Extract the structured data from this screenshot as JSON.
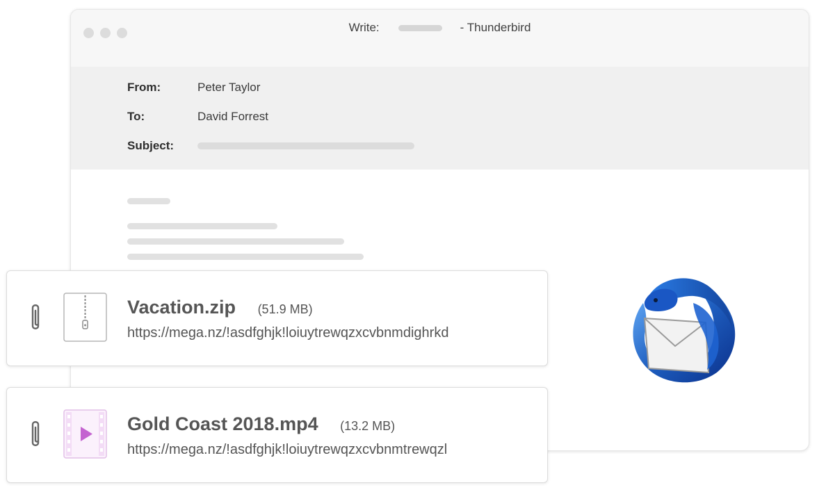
{
  "window": {
    "title_prefix": "Write:",
    "title_suffix": "- Thunderbird"
  },
  "compose": {
    "from_label": "From:",
    "from_value": "Peter Taylor",
    "to_label": "To:",
    "to_value": "David Forrest",
    "subject_label": "Subject:"
  },
  "attachments": [
    {
      "name": "Vacation.zip",
      "size": "(51.9 MB)",
      "link": "https://mega.nz/!asdfghjk!loiuytrewqzxcvbnmdighrkd",
      "icon": "zip-file-icon"
    },
    {
      "name": "Gold Coast 2018.mp4",
      "size": "(13.2 MB)",
      "link": "https://mega.nz/!asdfghjk!loiuytrewqzxcvbnmtrewqzl",
      "icon": "video-file-icon"
    }
  ],
  "logo": "thunderbird-logo",
  "colors": {
    "accent_blue": "#1f5fc0",
    "video_accent": "#c464d0"
  }
}
